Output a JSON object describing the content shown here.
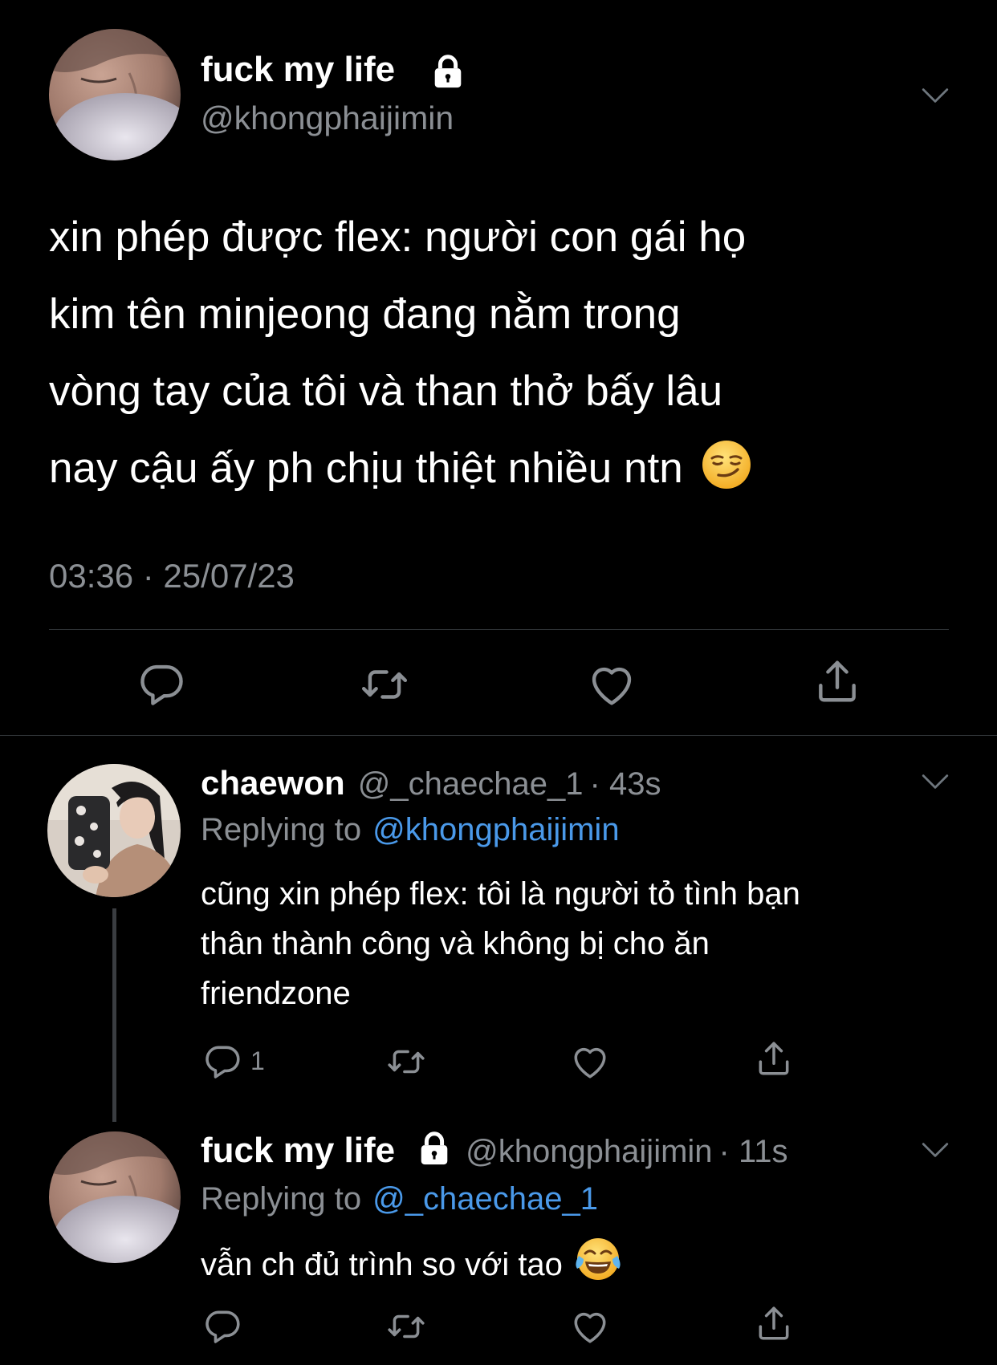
{
  "main_tweet": {
    "author_name": "fuck my life",
    "handle": "@khongphaijimin",
    "text_lines": [
      "xin phép được flex: người con gái họ",
      "kim tên minjeong đang nằm trong",
      "vòng tay của tôi và than thở bấy lâu",
      "nay cậu ấy ph chịu thiệt nhiều ntn"
    ],
    "emoji": "smirking-face",
    "timestamp": "03:36 · 25/07/23"
  },
  "replies": [
    {
      "author_name": "chaewon",
      "handle": "@_chaechae_1",
      "time": "· 43s",
      "replying_prefix": "Replying to",
      "replying_to": "@khongphaijimin",
      "text_lines": [
        "cũng xin phép flex: tôi là người tỏ tình bạn",
        "thân thành công và không bị cho ăn",
        "friendzone"
      ],
      "reply_count": "1"
    },
    {
      "author_name": "fuck my life",
      "handle": "@khongphaijimin",
      "time": "· 11s",
      "replying_prefix": "Replying to",
      "replying_to": "@_chaechae_1",
      "text_lines": [
        "vẫn ch đủ trình so với tao"
      ],
      "emoji": "face-with-tears-of-joy"
    }
  ],
  "icons": {
    "lock": "lock-icon",
    "chevron": "chevron-down-icon",
    "reply": "reply-icon",
    "retweet": "retweet-icon",
    "like": "heart-icon",
    "share": "share-icon"
  },
  "colors": {
    "background": "#000000",
    "text": "#ffffff",
    "muted": "#8b8f94",
    "link": "#4a99e9",
    "divider": "#2f3336"
  }
}
